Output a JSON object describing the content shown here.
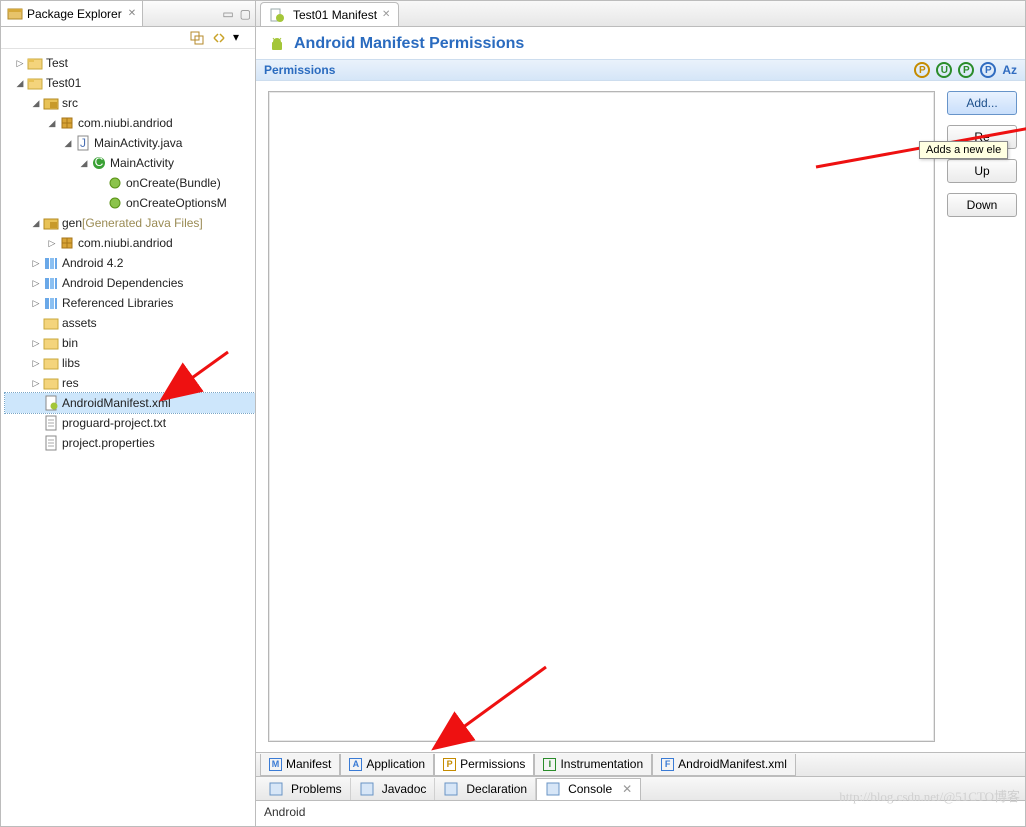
{
  "left": {
    "tab_label": "Package Explorer",
    "toolbar_icons": [
      "link-editor-icon",
      "view-menu-icon",
      "minimize-icon"
    ]
  },
  "tree": [
    {
      "d": 0,
      "tw": "▷",
      "ic": "project",
      "text": "Test"
    },
    {
      "d": 0,
      "tw": "◢",
      "ic": "project",
      "text": "Test01"
    },
    {
      "d": 1,
      "tw": "◢",
      "ic": "srcfolder",
      "text": "src"
    },
    {
      "d": 2,
      "tw": "◢",
      "ic": "package",
      "text": "com.niubi.andriod"
    },
    {
      "d": 3,
      "tw": "◢",
      "ic": "jfile",
      "text": "MainActivity.java"
    },
    {
      "d": 4,
      "tw": "◢",
      "ic": "class",
      "text": "MainActivity"
    },
    {
      "d": 5,
      "tw": "",
      "ic": "method",
      "text": "onCreate(Bundle)"
    },
    {
      "d": 5,
      "tw": "",
      "ic": "method",
      "text": "onCreateOptionsM"
    },
    {
      "d": 1,
      "tw": "◢",
      "ic": "srcfolder",
      "text": "gen ",
      "extra": "[Generated Java Files]",
      "muted": true
    },
    {
      "d": 2,
      "tw": "▷",
      "ic": "package",
      "text": "com.niubi.andriod"
    },
    {
      "d": 1,
      "tw": "▷",
      "ic": "lib",
      "text": "Android 4.2"
    },
    {
      "d": 1,
      "tw": "▷",
      "ic": "lib",
      "text": "Android Dependencies"
    },
    {
      "d": 1,
      "tw": "▷",
      "ic": "lib",
      "text": "Referenced Libraries"
    },
    {
      "d": 1,
      "tw": "",
      "ic": "folder",
      "text": "assets"
    },
    {
      "d": 1,
      "tw": "▷",
      "ic": "folder",
      "text": "bin"
    },
    {
      "d": 1,
      "tw": "▷",
      "ic": "folder",
      "text": "libs"
    },
    {
      "d": 1,
      "tw": "▷",
      "ic": "folder",
      "text": "res"
    },
    {
      "d": 1,
      "tw": "",
      "ic": "xmlfile",
      "text": "AndroidManifest.xml",
      "selected": true
    },
    {
      "d": 1,
      "tw": "",
      "ic": "txtfile",
      "text": "proguard-project.txt"
    },
    {
      "d": 1,
      "tw": "",
      "ic": "txtfile",
      "text": "project.properties"
    }
  ],
  "editor": {
    "tab_label": "Test01 Manifest",
    "form_title": "Android Manifest Permissions",
    "section_title": "Permissions",
    "badges": [
      "P",
      "U",
      "P",
      "P"
    ],
    "az_label": "Az",
    "buttons": {
      "add": "Add...",
      "remove": "Re",
      "up": "Up",
      "down": "Down"
    },
    "tooltip": "Adds a new ele",
    "sub_tabs": [
      {
        "code": "M",
        "color": "#3a7bd5",
        "label": "Manifest"
      },
      {
        "code": "A",
        "color": "#3a7bd5",
        "label": "Application"
      },
      {
        "code": "P",
        "color": "#c48b00",
        "label": "Permissions",
        "active": true
      },
      {
        "code": "I",
        "color": "#2a8c2a",
        "label": "Instrumentation"
      },
      {
        "code": "F",
        "color": "#3a7bd5",
        "label": "AndroidManifest.xml"
      }
    ]
  },
  "bottom": {
    "tabs": [
      {
        "label": "Problems",
        "icon": "problems-icon"
      },
      {
        "label": "Javadoc",
        "icon": "javadoc-icon"
      },
      {
        "label": "Declaration",
        "icon": "declaration-icon"
      },
      {
        "label": "Console",
        "icon": "console-icon",
        "active": true
      }
    ],
    "console_text": "Android"
  },
  "watermark": "http://blog.csdn.net/@51CTO博客"
}
